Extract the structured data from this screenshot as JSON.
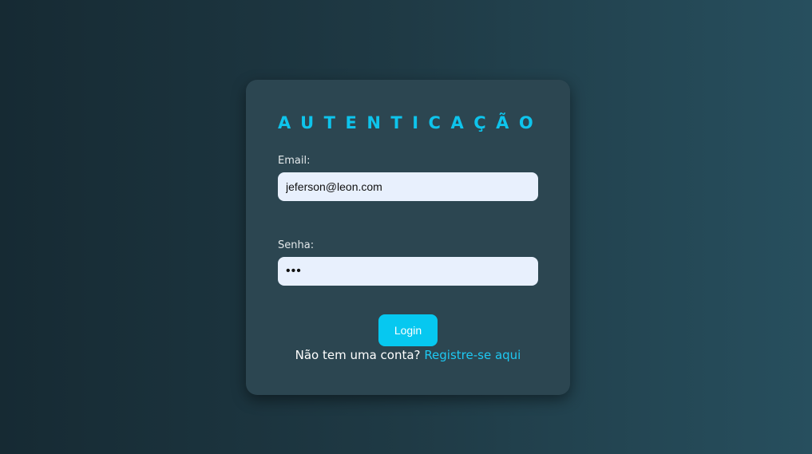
{
  "login_form": {
    "title": "AUTENTICAÇÃO",
    "email_label": "Email:",
    "email_value": "jeferson@leon.com",
    "password_label": "Senha:",
    "password_value": "•••",
    "login_button": "Login",
    "register_prompt": "Não tem uma conta?",
    "register_link": "Registre-se aqui"
  },
  "colors": {
    "accent": "#06c8f0",
    "card_background": "#2c4651",
    "input_background": "#e8f0fd"
  }
}
